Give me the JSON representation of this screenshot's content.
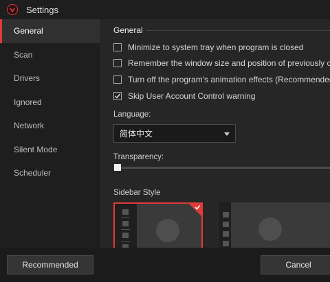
{
  "window": {
    "title": "Settings"
  },
  "sidebar": {
    "items": [
      {
        "label": "General",
        "active": true
      },
      {
        "label": "Scan"
      },
      {
        "label": "Drivers"
      },
      {
        "label": "Ignored"
      },
      {
        "label": "Network"
      },
      {
        "label": "Silent Mode"
      },
      {
        "label": "Scheduler"
      }
    ]
  },
  "general": {
    "section_title": "General",
    "options": [
      {
        "label": "Minimize to system tray when program is closed",
        "checked": false
      },
      {
        "label": "Remember the window size and position of previously opene",
        "checked": false
      },
      {
        "label": "Turn off the program's animation effects (Recommended for",
        "checked": false
      },
      {
        "label": "Skip User Account Control warning",
        "checked": true
      }
    ],
    "language_label": "Language:",
    "language_value": "简体中文",
    "transparency_label": "Transparency:",
    "transparency_value": 0,
    "sidebar_style_label": "Sidebar Style"
  },
  "footer": {
    "recommended_label": "Recommended",
    "cancel_label": "Cancel"
  },
  "colors": {
    "accent": "#e03a3a",
    "background": "#262626",
    "sidebar": "#1e1e1e"
  }
}
